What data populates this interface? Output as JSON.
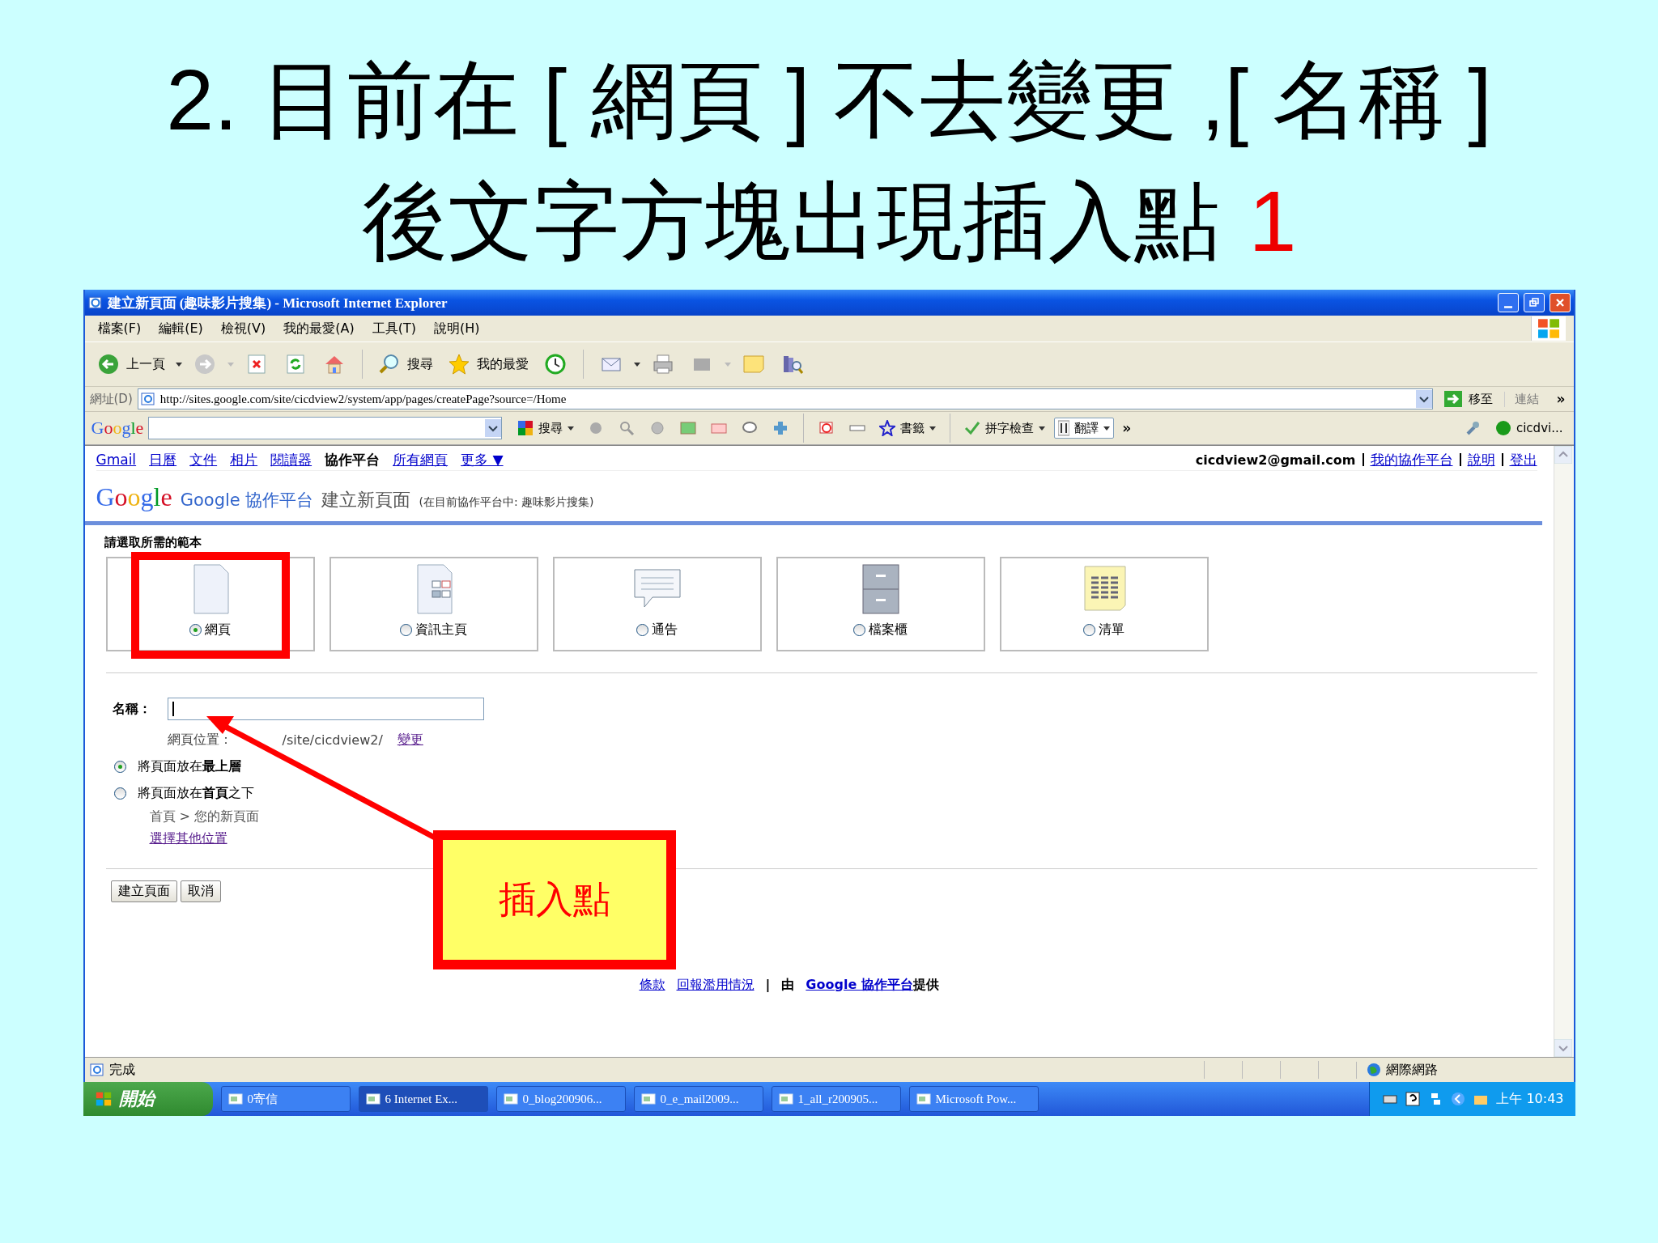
{
  "slide": {
    "title_line1": "2. 目前在 [ 網頁 ] 不去變更 ,[ 名稱 ]",
    "title_line2": "後文字方塊出現插入點",
    "title_number": "1"
  },
  "window": {
    "title": "建立新頁面 (趣味影片搜集) - Microsoft Internet Explorer"
  },
  "menu": [
    "檔案(F)",
    "編輯(E)",
    "檢視(V)",
    "我的最愛(A)",
    "工具(T)",
    "說明(H)"
  ],
  "toolbar": {
    "back": "上一頁",
    "search": "搜尋",
    "favorites": "我的最愛"
  },
  "address_bar": {
    "label": "網址(D)",
    "url": "http://sites.google.com/site/cicdview2/system/app/pages/createPage?source=/Home",
    "go": "移至",
    "links": "連結",
    "more": "»"
  },
  "google_toolbar": {
    "logo": "Google",
    "search": "搜尋",
    "bookmarks": "書籤",
    "spellcheck": "拼字檢查",
    "translate": "翻譯",
    "more": "»",
    "account": "cicdvi..."
  },
  "nav_links": [
    {
      "label": "Gmail",
      "selected": false
    },
    {
      "label": "日曆",
      "selected": false
    },
    {
      "label": "文件",
      "selected": false
    },
    {
      "label": "相片",
      "selected": false
    },
    {
      "label": "閱讀器",
      "selected": false
    },
    {
      "label": "協作平台",
      "selected": true
    },
    {
      "label": "所有網頁",
      "selected": false
    },
    {
      "label": "更多 ▼",
      "selected": false
    }
  ],
  "account": {
    "email": "cicdview2@gmail.com",
    "links": [
      "我的協作平台",
      "說明",
      "登出"
    ]
  },
  "header": {
    "logo": "Google",
    "product": "Google 協作平台",
    "page_title": "建立新頁面",
    "context": "(在目前協作平台中: 趣味影片搜集)"
  },
  "template_heading": "請選取所需的範本",
  "templates": [
    {
      "label": "網頁",
      "kind": "page",
      "selected": true
    },
    {
      "label": "資訊主頁",
      "kind": "dashboard",
      "selected": false
    },
    {
      "label": "通告",
      "kind": "announcement",
      "selected": false
    },
    {
      "label": "檔案櫃",
      "kind": "cabinet",
      "selected": false
    },
    {
      "label": "清單",
      "kind": "list",
      "selected": false
    }
  ],
  "name_field": {
    "label": "名稱："
  },
  "location": {
    "label": "網頁位置：",
    "path": "/site/cicdview2/",
    "change_link": "變更"
  },
  "placement": [
    {
      "text": "將頁面放在**最上層**",
      "selected": true
    },
    {
      "text": "將頁面放在**首頁**之下",
      "selected": false
    }
  ],
  "breadcrumb": "首頁 > 您的新頁面",
  "other_location_link": "選擇其他位置",
  "buttons": [
    "建立頁面",
    "取消"
  ],
  "footer": {
    "terms": "條款",
    "report": "回報濫用情況",
    "separator": "|",
    "by": "由",
    "site_link": "Google 協作平台",
    "provided": "提供"
  },
  "callout": {
    "text": "插入點"
  },
  "status_bar": {
    "text": "完成",
    "zone": "網際網路"
  },
  "taskbar": {
    "start": "開始",
    "items": [
      {
        "label": "0寄信",
        "selected": false
      },
      {
        "label": "6 Internet Ex...",
        "selected": true
      },
      {
        "label": "0_blog200906...",
        "selected": false
      },
      {
        "label": "0_e_mail2009...",
        "selected": false
      },
      {
        "label": "1_all_r200905...",
        "selected": false
      },
      {
        "label": "Microsoft Pow...",
        "selected": false
      }
    ],
    "clock": "上午 10:43"
  }
}
